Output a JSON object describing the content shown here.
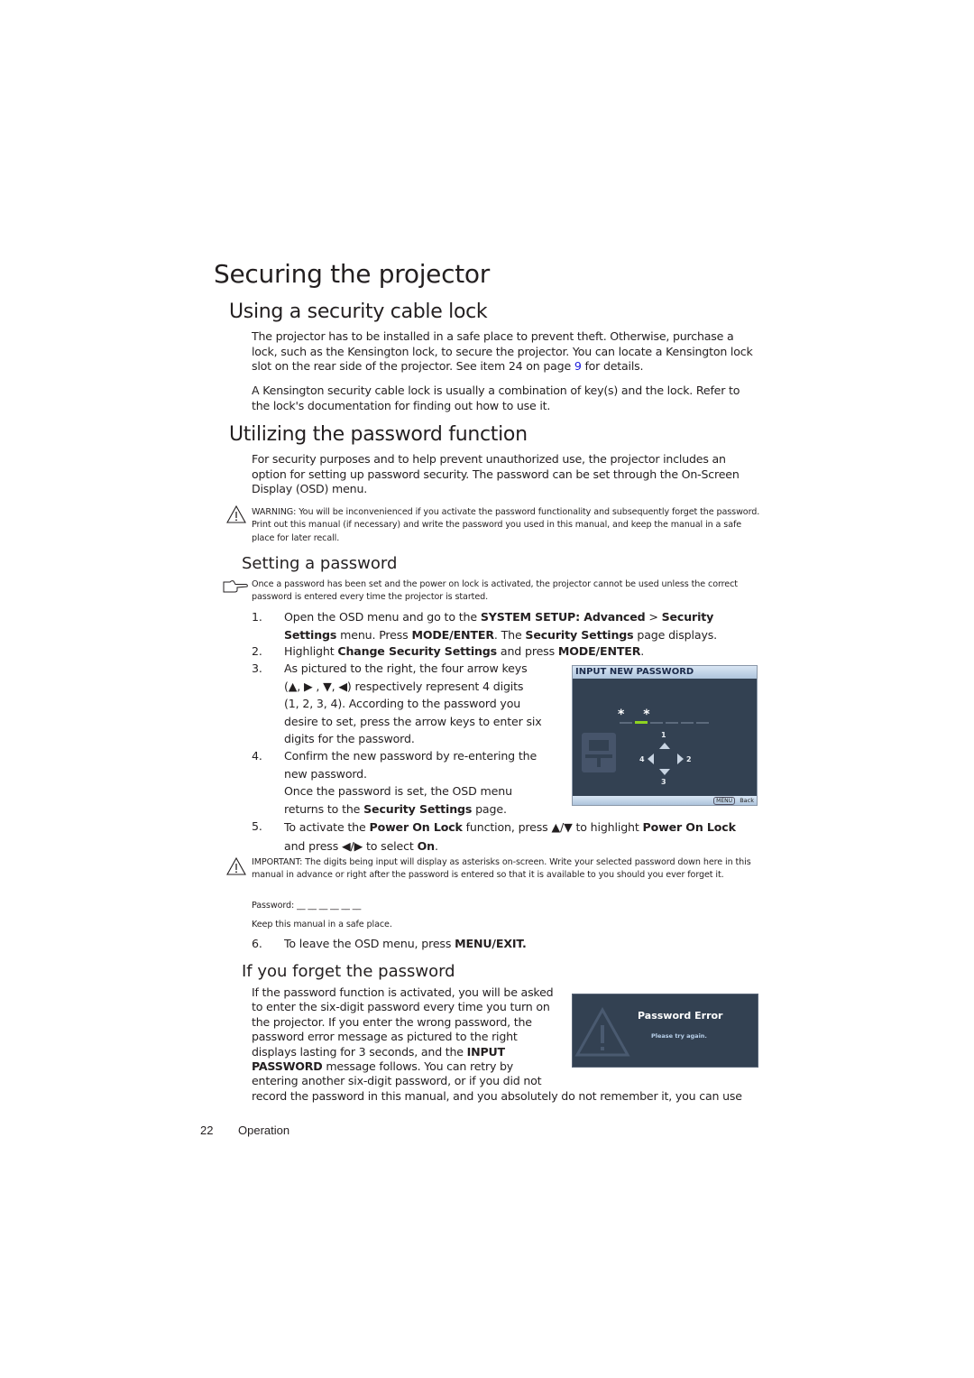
{
  "page": {
    "title": "Securing the projector",
    "page_number": "22",
    "section_footer": "Operation"
  },
  "cable_lock": {
    "heading": "Using a security cable lock",
    "para1_a": "The projector has to be installed in a safe place to prevent theft. Otherwise, purchase a lock, such as the Kensington lock, to secure the projector. You can locate a Kensington lock slot on the rear side of the projector. See item 24 on page ",
    "para1_link": "9",
    "para1_b": " for details.",
    "para2": "A Kensington security cable lock is usually a combination of key(s) and the lock. Refer to the lock's documentation for finding out how to use it."
  },
  "password_function": {
    "heading": "Utilizing the password function",
    "para": "For security purposes and to help prevent unauthorized use, the projector includes an option for setting up password security. The password can be set through the On-Screen Display (OSD) menu.",
    "warning": "WARNING: You will be inconvenienced if you activate the password functionality and subsequently forget the password. Print out this manual (if necessary) and write the password you used in this manual, and keep the manual in a safe place for later recall.",
    "warning_icon": "warning-triangle-icon"
  },
  "setting_password": {
    "heading": "Setting a password",
    "note": "Once a password has been set and the power on lock is activated, the projector cannot be used unless the correct password is entered every time the projector is started.",
    "note_icon": "pointing-hand-icon",
    "steps": [
      {
        "num": "1.",
        "parts": [
          "Open the OSD menu and go to the ",
          "SYSTEM SETUP: Advanced",
          " > ",
          "Security Settings",
          " menu. Press ",
          "MODE/ENTER",
          ". The ",
          "Security Settings",
          " page displays."
        ]
      },
      {
        "num": "2.",
        "parts": [
          "Highlight ",
          "Change Security Settings",
          " and press ",
          "MODE/ENTER",
          "."
        ]
      },
      {
        "num": "3.",
        "line1": "As pictured to the right, the four arrow keys",
        "line2": "(▲, ▶ , ▼, ◀) respectively represent 4 digits",
        "line3": "(1, 2, 3, 4). According to the password you",
        "line4": "desire to set, press the arrow keys to enter six",
        "line5": "digits for the password."
      },
      {
        "num": "4.",
        "line1": "Confirm the new password by re-entering the",
        "line2": "new password.",
        "line3": "Once the password is set, the OSD menu",
        "line4a": "returns to the ",
        "line4b": "Security Settings",
        "line4c": " page."
      },
      {
        "num": "5.",
        "a": "To activate the ",
        "b": "Power On Lock",
        "c": " function, press ▲/▼ to highlight ",
        "d": "Power On Lock",
        "e": "and press ◀/▶  to select ",
        "f": "On",
        "g": "."
      },
      {
        "num": "6.",
        "a": "To leave the OSD menu, press ",
        "b": "MENU/EXIT."
      }
    ],
    "important": "IMPORTANT: The digits being input will display as asterisks on-screen. Write your selected password down here in this manual in advance or right after the password is entered so that it is available to you should you ever forget it.",
    "password_line": "Password: __ __ __ __ __ __",
    "keep_note": "Keep this manual in a safe place."
  },
  "osd_input": {
    "title": "INPUT NEW PASSWORD",
    "entered": "* *",
    "digit_up": "1",
    "digit_right": "2",
    "digit_down": "3",
    "digit_left": "4",
    "menu_key": "MENU",
    "back_label": "Back",
    "active_color": "#8ed321",
    "bg_color": "#334152"
  },
  "forget_password": {
    "heading": "If you forget the password",
    "line1": "If the password function is activated, you will be asked",
    "line2": "to enter the six-digit password every time you turn on",
    "line3": "the projector. If you enter the wrong password, the",
    "line4": "password error message as pictured to the right",
    "line5a": "displays lasting for 3 seconds, and the ",
    "line5b": "INPUT",
    "line6a": "PASSWORD",
    "line6b": " message follows. You can retry by",
    "line7": "entering another six-digit password, or if you did not",
    "line8": "record the password in this manual, and you absolutely do not remember it, you can use"
  },
  "osd_error": {
    "title": "Password Error",
    "subtitle": "Please try again."
  }
}
